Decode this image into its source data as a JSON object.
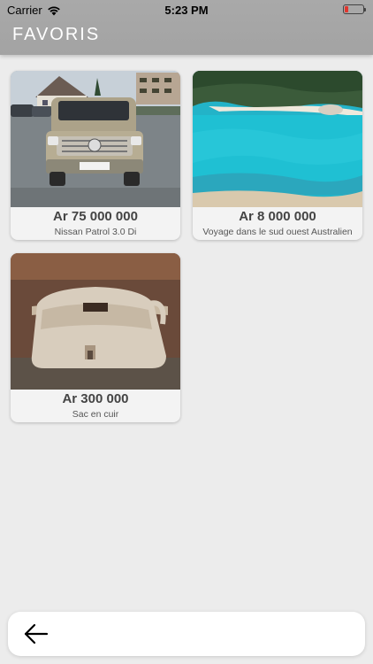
{
  "status_bar": {
    "carrier": "Carrier",
    "time": "5:23 PM",
    "battery_color": "#e0362e"
  },
  "header": {
    "title": "FAVORIS",
    "background": "#a6a6a6"
  },
  "favorites": [
    {
      "price": "Ar 75 000 000",
      "title": "Nissan Patrol 3.0 Di",
      "image": "silver-suv-photo"
    },
    {
      "price": "Ar 8 000 000",
      "title": "Voyage dans le sud ouest Australien",
      "image": "turquoise-beach-photo"
    },
    {
      "price": "Ar 300 000",
      "title": "Sac en cuir",
      "image": "leather-bag-photo"
    }
  ],
  "bottom_bar": {
    "back_icon": "arrow-left-icon"
  }
}
